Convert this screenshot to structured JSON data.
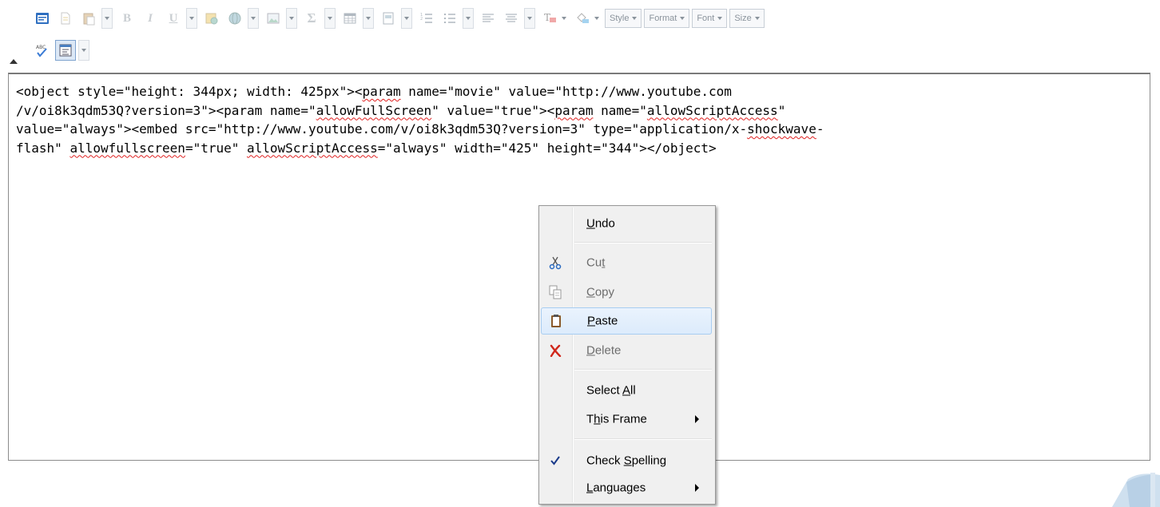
{
  "toolbar": {
    "row1_buttons": [
      {
        "icon": "design-view-icon",
        "state": "normal"
      },
      {
        "icon": "new-document-icon",
        "state": "dim"
      },
      {
        "icon": "paste-icon",
        "state": "dim"
      },
      {
        "icon": "bold-icon",
        "glyph": "B",
        "state": "dim"
      },
      {
        "icon": "italic-icon",
        "glyph": "I",
        "state": "dim"
      },
      {
        "icon": "underline-icon",
        "glyph": "U",
        "state": "dim"
      },
      {
        "icon": "insert-link-icon",
        "state": "dim"
      },
      {
        "icon": "insert-image-icon",
        "state": "dim"
      },
      {
        "icon": "insert-symbol-icon",
        "glyph": "Σ",
        "state": "dim"
      },
      {
        "icon": "insert-table-icon",
        "state": "dim"
      },
      {
        "icon": "insert-template-icon",
        "state": "dim"
      },
      {
        "icon": "numbered-list-icon",
        "state": "dim"
      },
      {
        "icon": "align-icon",
        "state": "dim"
      },
      {
        "icon": "text-color-icon",
        "state": "dim"
      },
      {
        "icon": "highlight-color-icon",
        "state": "dim"
      }
    ],
    "combos": {
      "style": "Style",
      "format": "Format",
      "font": "Font",
      "size": "Size"
    },
    "row2_buttons": [
      {
        "icon": "spellcheck-icon",
        "glyph": "ABC"
      },
      {
        "icon": "html-source-icon",
        "state": "active"
      }
    ]
  },
  "editor": {
    "line1": "<object style=\"height: 344px; width: 425px\"><",
    "line1_sp1": "param",
    "line1_rest": " name=\"movie\" value=\"http://www.youtube.com",
    "line2a": "/v/oi8k3qdm53Q?version=3\"><param name=\"",
    "line2_sp1": "allowFullScreen",
    "line2b": "\" value=\"true\"><",
    "line2_sp2": "param",
    "line2c": " name=\"",
    "line2_sp3": "allowScriptAccess",
    "line2d": "\"",
    "line3a": "value=\"always\"><embed src=\"http://www.youtube.com/v/oi8k3qdm53Q?version=3\" type=\"application/x-",
    "line3_sp1": "shockwave",
    "line3b": "-",
    "line4a": "flash\" ",
    "line4_sp1": "allowfullscreen",
    "line4b": "=\"true\" ",
    "line4_sp2": "allowScriptAccess",
    "line4c": "=\"always\" width=\"425\" height=\"344\"></object>"
  },
  "context_menu": {
    "undo": {
      "pre": "",
      "key": "U",
      "post": "ndo"
    },
    "cut": {
      "pre": "Cu",
      "key": "t",
      "post": ""
    },
    "copy": {
      "pre": "",
      "key": "C",
      "post": "opy"
    },
    "paste": {
      "pre": "",
      "key": "P",
      "post": "aste"
    },
    "delete": {
      "pre": "",
      "key": "D",
      "post": "elete"
    },
    "select_all": {
      "pre": "Select ",
      "key": "A",
      "post": "ll"
    },
    "this_frame": {
      "pre": "T",
      "key": "h",
      "post": "is Frame"
    },
    "check_spelling": {
      "pre": "Check ",
      "key": "S",
      "post": "pelling",
      "checked": true
    },
    "languages": {
      "pre": "",
      "key": "L",
      "post": "anguages"
    }
  },
  "colors": {
    "menu_bg": "#f0f0f0",
    "hover_border": "#a8cdf1",
    "spell_underline": "#e02020",
    "disabled_text": "#6d6d6d"
  }
}
